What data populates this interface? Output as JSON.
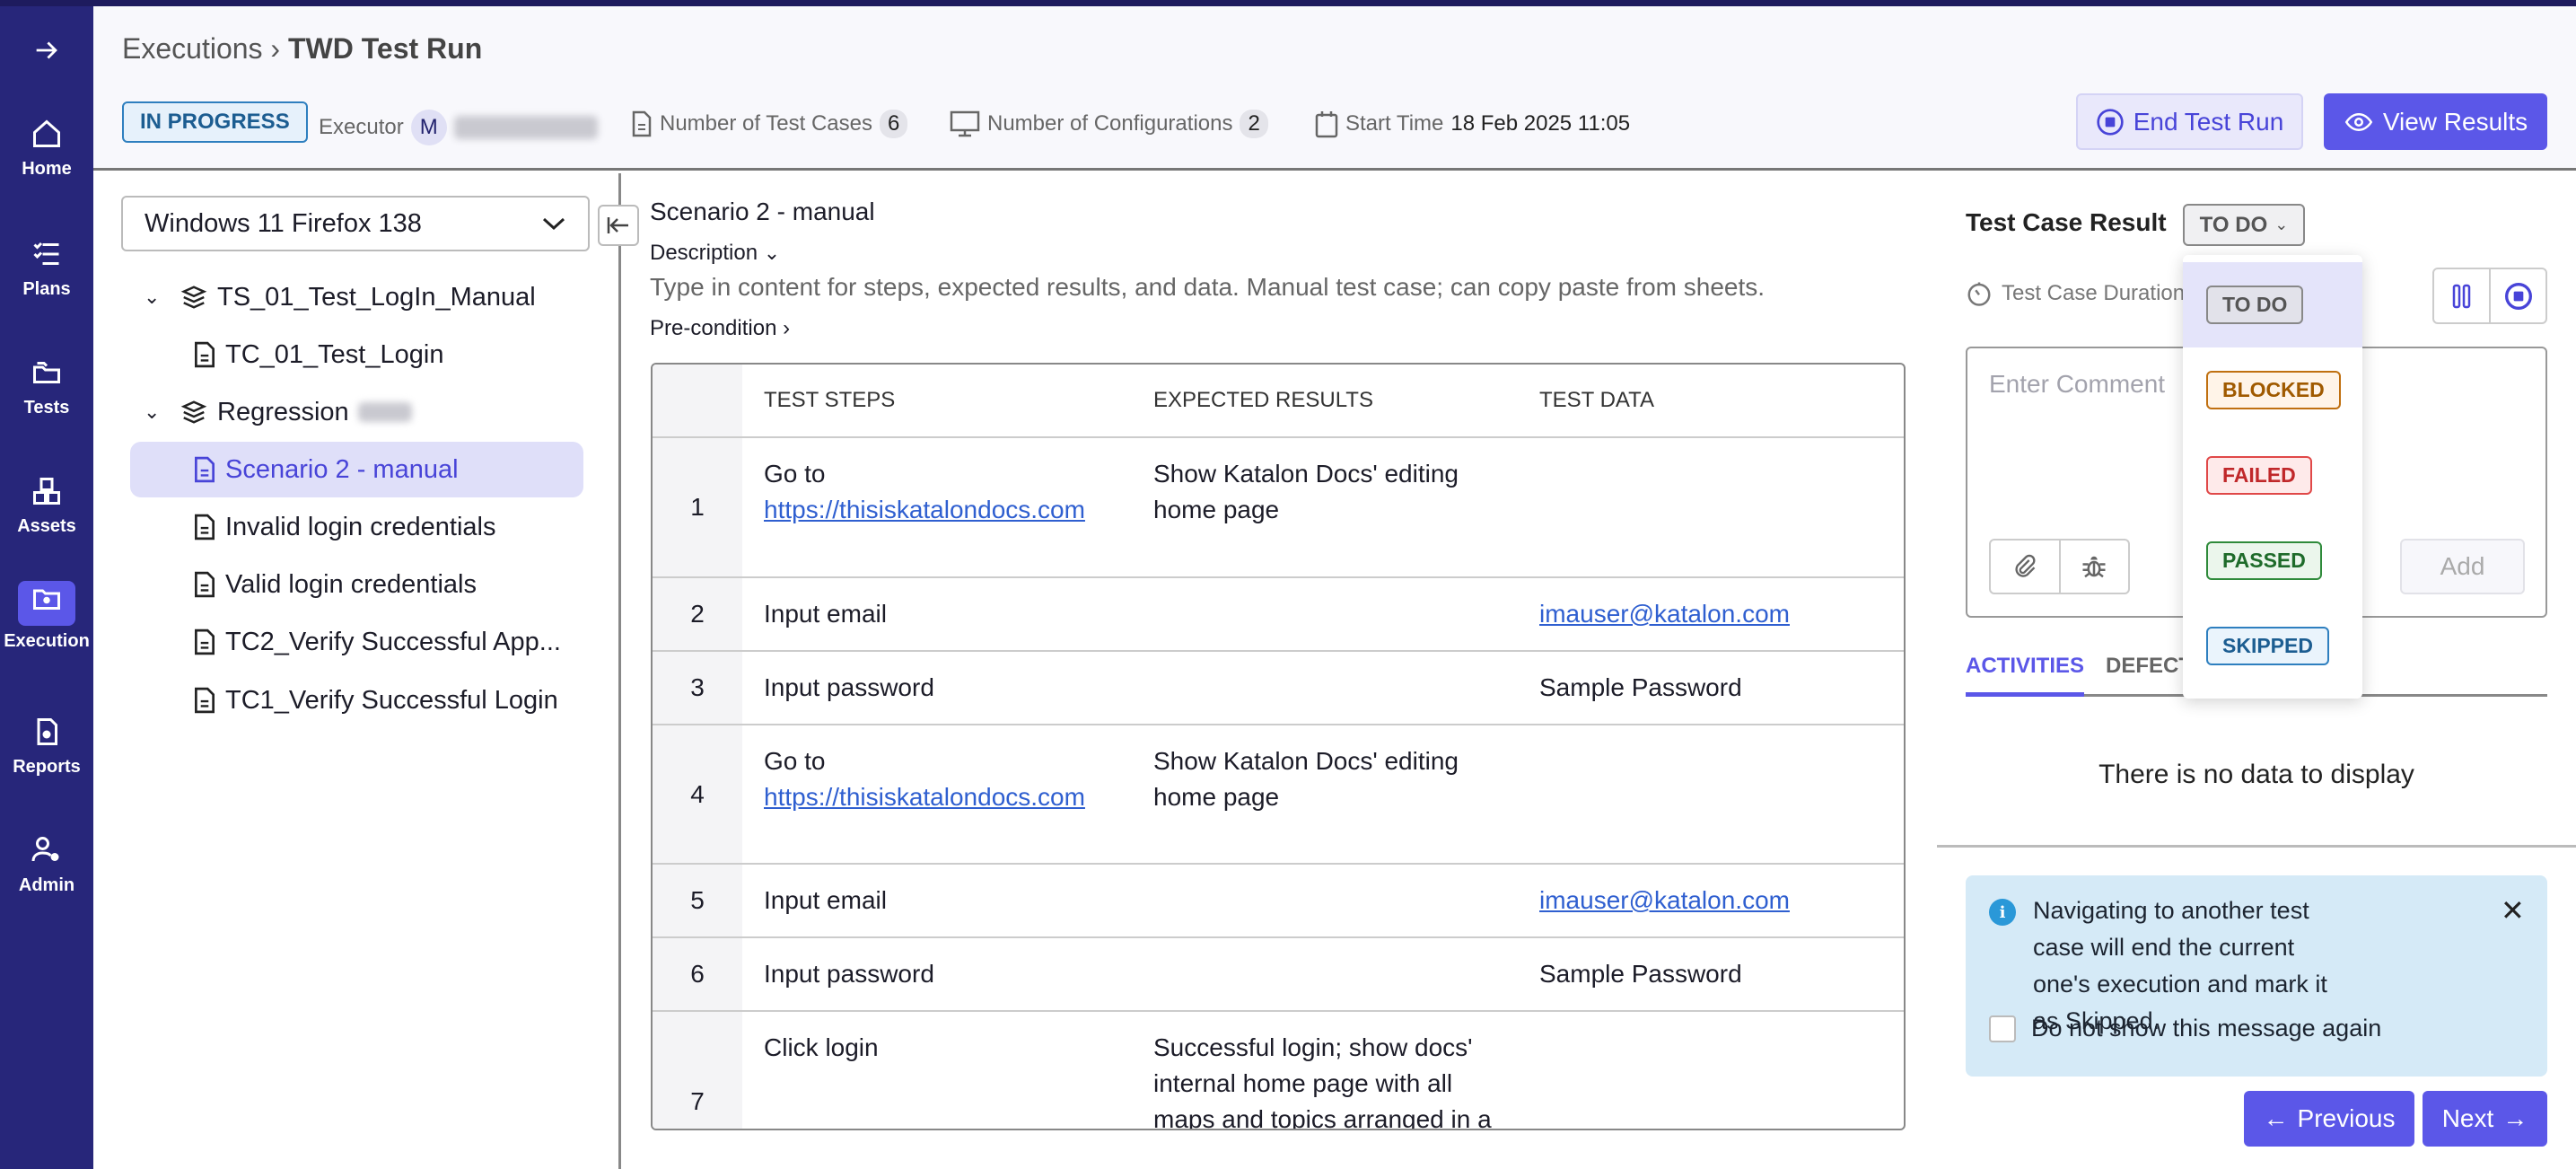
{
  "sidebar": {
    "items": [
      {
        "label": "Home",
        "icon": "home-icon"
      },
      {
        "label": "Plans",
        "icon": "checklist-icon"
      },
      {
        "label": "Tests",
        "icon": "folders-icon"
      },
      {
        "label": "Assets",
        "icon": "boxes-icon"
      },
      {
        "label": "Execution",
        "icon": "folder-gear-icon",
        "active": true
      },
      {
        "label": "Reports",
        "icon": "report-icon"
      },
      {
        "label": "Admin",
        "icon": "user-gear-icon"
      }
    ]
  },
  "header": {
    "breadcrumb_parent": "Executions",
    "separator": "›",
    "title": "TWD Test Run",
    "status": "IN PROGRESS",
    "executor_label": "Executor",
    "executor_initial": "M",
    "test_cases_label": "Number of Test Cases",
    "test_cases_count": "6",
    "configs_label": "Number of Configurations",
    "configs_count": "2",
    "start_time_label": "Start Time",
    "start_time": "18 Feb 2025 11:05",
    "end_button": "End Test Run",
    "view_button": "View Results"
  },
  "left": {
    "configuration": "Windows 11 Firefox 138",
    "tree": [
      {
        "label": "TS_01_Test_LogIn_Manual",
        "type": "suite"
      },
      {
        "label": "TC_01_Test_Login",
        "type": "case"
      },
      {
        "label": "Regression",
        "type": "suite"
      },
      {
        "label": "Scenario 2 - manual",
        "type": "case",
        "selected": true
      },
      {
        "label": "Invalid login credentials",
        "type": "case"
      },
      {
        "label": "Valid login credentials",
        "type": "case"
      },
      {
        "label": "TC2_Verify Successful App...",
        "type": "case"
      },
      {
        "label": "TC1_Verify Successful Login",
        "type": "case"
      }
    ]
  },
  "main": {
    "title": "Scenario 2 - manual",
    "description_label": "Description",
    "description": "Type in content for steps, expected results, and data. Manual test case; can copy paste from sheets.",
    "precondition_label": "Pre-condition",
    "columns": [
      "TEST STEPS",
      "EXPECTED RESULTS",
      "TEST DATA"
    ],
    "rows": [
      {
        "n": "1",
        "step": "Go to ",
        "link": "https://thisiskatalondocs.com",
        "expected": "Show Katalon Docs' editing home page",
        "data": "",
        "data_link": false
      },
      {
        "n": "2",
        "step": "Input email",
        "link": "",
        "expected": "",
        "data": "imauser@katalon.com",
        "data_link": true
      },
      {
        "n": "3",
        "step": "Input password",
        "link": "",
        "expected": "",
        "data": "Sample Password",
        "data_link": false
      },
      {
        "n": "4",
        "step": "Go to ",
        "link": "https://thisiskatalondocs.com",
        "expected": "Show Katalon Docs' editing home page",
        "data": "",
        "data_link": false
      },
      {
        "n": "5",
        "step": "Input email",
        "link": "",
        "expected": "",
        "data": "imauser@katalon.com",
        "data_link": true
      },
      {
        "n": "6",
        "step": "Input password",
        "link": "",
        "expected": "",
        "data": "Sample Password",
        "data_link": false
      },
      {
        "n": "7",
        "step": "Click login",
        "link": "",
        "expected": "Successful login; show docs' internal home page with all maps and topics arranged in a saved view - currently a",
        "data": "",
        "data_link": false
      }
    ]
  },
  "right": {
    "result_label": "Test Case Result",
    "result_value": "TO DO",
    "duration_label": "Test Case Duration",
    "comment_placeholder": "Enter Comment",
    "add_button": "Add",
    "tabs": [
      "ACTIVITIES",
      "DEFECTS"
    ],
    "empty": "There is no data to display",
    "info": "Navigating to another test case will end the current one's execution and mark it as Skipped.",
    "dont_show": "Do not show this message again",
    "prev": "Previous",
    "next": "Next",
    "options": [
      {
        "label": "TO DO",
        "color": "#555555",
        "bg": "#e2e2ea",
        "border": "#888888"
      },
      {
        "label": "BLOCKED",
        "color": "#a05a00",
        "bg": "#fff4e8",
        "border": "#c07010"
      },
      {
        "label": "FAILED",
        "color": "#c0282a",
        "bg": "#feeaea",
        "border": "#e04848"
      },
      {
        "label": "PASSED",
        "color": "#1e6b2a",
        "bg": "#ebf6ec",
        "border": "#2e8a3a"
      },
      {
        "label": "SKIPPED",
        "color": "#1c5d91",
        "bg": "#eaf4fc",
        "border": "#2e7fbf"
      }
    ]
  }
}
